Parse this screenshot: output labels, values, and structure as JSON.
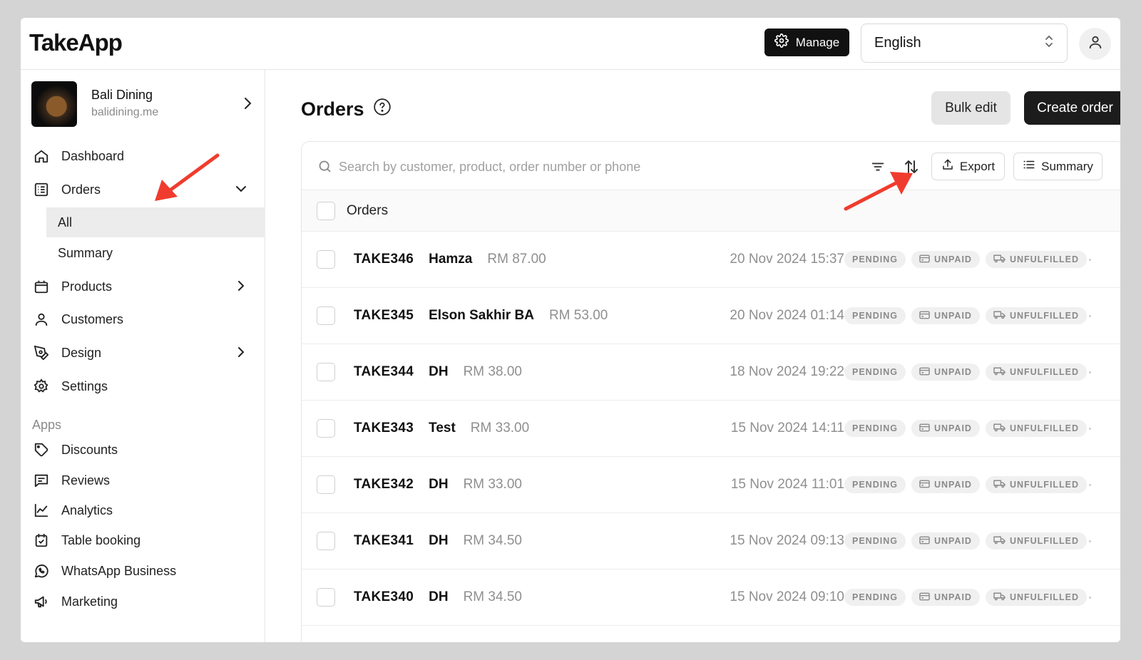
{
  "topbar": {
    "logo": "TakeApp",
    "manage_label": "Manage",
    "language": "English"
  },
  "sidebar": {
    "store": {
      "name": "Bali Dining",
      "url": "balidining.me"
    },
    "nav": [
      {
        "label": "Dashboard",
        "icon": "home-icon"
      },
      {
        "label": "Orders",
        "icon": "orders-icon",
        "expanded": true
      },
      {
        "label": "Products",
        "icon": "products-icon"
      },
      {
        "label": "Customers",
        "icon": "customers-icon"
      },
      {
        "label": "Design",
        "icon": "design-icon"
      },
      {
        "label": "Settings",
        "icon": "settings-icon"
      }
    ],
    "orders_sub": [
      {
        "label": "All",
        "active": true
      },
      {
        "label": "Summary"
      }
    ],
    "apps_label": "Apps",
    "apps": [
      {
        "label": "Discounts",
        "icon": "tag-icon"
      },
      {
        "label": "Reviews",
        "icon": "reviews-icon"
      },
      {
        "label": "Analytics",
        "icon": "analytics-icon"
      },
      {
        "label": "Table booking",
        "icon": "calendar-icon"
      },
      {
        "label": "WhatsApp Business",
        "icon": "whatsapp-icon"
      },
      {
        "label": "Marketing",
        "icon": "megaphone-icon"
      }
    ]
  },
  "main": {
    "title": "Orders",
    "bulk_edit_label": "Bulk edit",
    "create_order_label": "Create order",
    "search_placeholder": "Search by customer, product, order number or phone",
    "export_label": "Export",
    "summary_label": "Summary",
    "list_header": "Orders",
    "orders": [
      {
        "id": "TAKE346",
        "customer": "Hamza",
        "amount": "RM 87.00",
        "date": "20 Nov 2024 15:37",
        "status": "PENDING",
        "payment": "UNPAID",
        "fulfillment": "UNFULFILLED"
      },
      {
        "id": "TAKE345",
        "customer": "Elson Sakhir BA",
        "amount": "RM 53.00",
        "date": "20 Nov 2024 01:14",
        "status": "PENDING",
        "payment": "UNPAID",
        "fulfillment": "UNFULFILLED"
      },
      {
        "id": "TAKE344",
        "customer": "DH",
        "amount": "RM 38.00",
        "date": "18 Nov 2024 19:22",
        "status": "PENDING",
        "payment": "UNPAID",
        "fulfillment": "UNFULFILLED"
      },
      {
        "id": "TAKE343",
        "customer": "Test",
        "amount": "RM 33.00",
        "date": "15 Nov 2024 14:11",
        "status": "PENDING",
        "payment": "UNPAID",
        "fulfillment": "UNFULFILLED"
      },
      {
        "id": "TAKE342",
        "customer": "DH",
        "amount": "RM 33.00",
        "date": "15 Nov 2024 11:01",
        "status": "PENDING",
        "payment": "UNPAID",
        "fulfillment": "UNFULFILLED"
      },
      {
        "id": "TAKE341",
        "customer": "DH",
        "amount": "RM 34.50",
        "date": "15 Nov 2024 09:13",
        "status": "PENDING",
        "payment": "UNPAID",
        "fulfillment": "UNFULFILLED"
      },
      {
        "id": "TAKE340",
        "customer": "DH",
        "amount": "RM 34.50",
        "date": "15 Nov 2024 09:10",
        "status": "PENDING",
        "payment": "UNPAID",
        "fulfillment": "UNFULFILLED"
      }
    ]
  },
  "colors": {
    "background": "#d4d4d4",
    "primary_button": "#111111",
    "annotation_arrow": "#f03c2e",
    "badge_bg": "#f0f0f0",
    "muted_text": "#8f8f8f"
  }
}
